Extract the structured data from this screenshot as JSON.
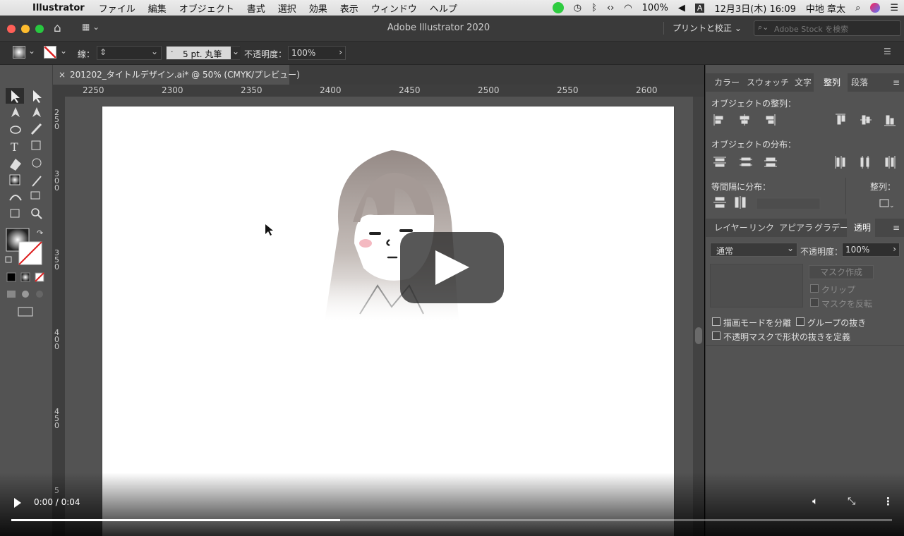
{
  "menubar": {
    "apple": "",
    "app": "Illustrator",
    "items": [
      "ファイル",
      "編集",
      "オブジェクト",
      "書式",
      "選択",
      "効果",
      "表示",
      "ウィンドウ",
      "ヘルプ"
    ],
    "battery": "100%",
    "input": "A",
    "datetime": "12月3日(木) 16:09",
    "user": "中地 章太"
  },
  "window": {
    "title": "Adobe Illustrator 2020",
    "workspace": "プリントと校正",
    "stock_search_placeholder": "Adobe Stock を検索"
  },
  "control": {
    "stroke_label": "線：",
    "brush": "5 pt. 丸筆",
    "opacity_label": "不透明度：",
    "opacity_value": "100%"
  },
  "document": {
    "tab": "201202_タイトルデザイン.ai* @ 50% (CMYK/プレビュー)"
  },
  "ruler": {
    "h_ticks": [
      "2250",
      "2300",
      "2350",
      "2400",
      "2450",
      "2500",
      "2550",
      "2600"
    ],
    "v_ticks": [
      "250",
      "300",
      "350",
      "400",
      "450",
      "5"
    ]
  },
  "panels": {
    "top_tabs": [
      "カラー",
      "スウォッチ",
      "文字",
      "整列",
      "段落"
    ],
    "align_objects": "オブジェクトの整列：",
    "distribute_objects": "オブジェクトの分布：",
    "distribute_spacing": "等間隔に分布：",
    "align_to": "整列：",
    "bottom_tabs": [
      "レイヤー",
      "リンク",
      "アピアラ",
      "グラデー",
      "透明"
    ],
    "blend_mode": "通常",
    "opacity_label": "不透明度：",
    "opacity_value": "100%",
    "mask_button": "マスク作成",
    "clip": "クリップ",
    "invert_mask": "マスクを反転",
    "isolate_blending": "描画モードを分離",
    "knockout_group": "グループの抜き",
    "opacity_mask_knockout": "不透明マスクで形状の抜きを定義"
  },
  "video": {
    "time": "0:00 / 0:04",
    "progress": 0.373
  },
  "colors": {
    "accent_red": "#ff5f57",
    "accent_yellow": "#febc2e",
    "accent_green": "#28c840"
  }
}
